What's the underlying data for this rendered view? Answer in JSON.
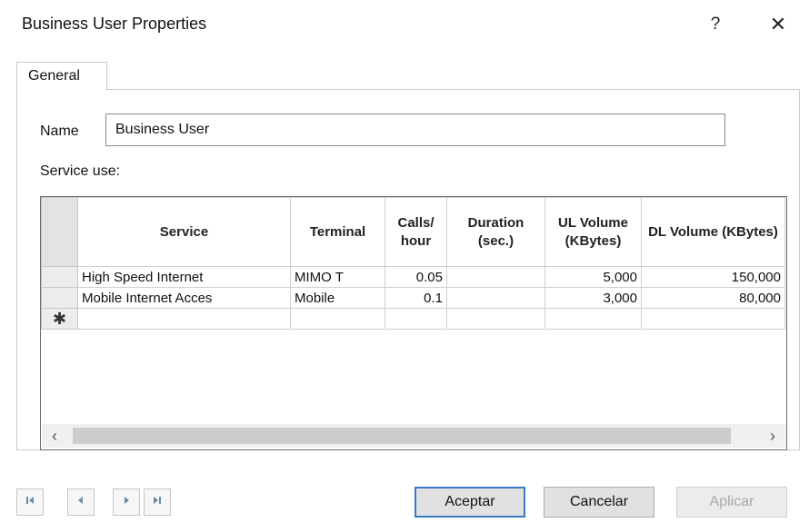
{
  "window": {
    "title": "Business User Properties",
    "help_glyph": "?",
    "close_glyph": "✕"
  },
  "tabs": [
    {
      "label": "General",
      "selected": true
    }
  ],
  "form": {
    "name_label": "Name",
    "name_value": "Business User",
    "service_use_label": "Service use:"
  },
  "grid": {
    "columns": [
      "Service",
      "Terminal",
      "Calls/ hour",
      "Duration (sec.)",
      "UL Volume (KBytes)",
      "DL Volume (KBytes)"
    ],
    "rows": [
      [
        "High Speed Internet",
        "MIMO T",
        "0.05",
        "",
        "5,000",
        "150,000"
      ],
      [
        "Mobile Internet Acces",
        "Mobile",
        "0.1",
        "",
        "3,000",
        "80,000"
      ]
    ],
    "new_row_marker": "✱"
  },
  "navigation": {
    "first_icon": "first-record-icon",
    "prev_icon": "previous-record-icon",
    "next_icon": "next-record-icon",
    "last_icon": "last-record-icon"
  },
  "buttons": {
    "ok": "Aceptar",
    "cancel": "Cancelar",
    "apply": "Aplicar"
  },
  "colors": {
    "default_button_border": "#3a78c8",
    "nav_icon": "#6f8aa8",
    "disabled_text": "#a8a8a8"
  }
}
